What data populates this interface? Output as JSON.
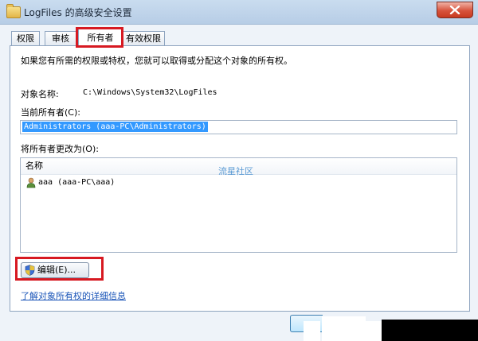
{
  "window": {
    "title": "LogFiles 的高级安全设置",
    "icon": "folder-icon",
    "close_icon": "close-icon"
  },
  "tabs": [
    {
      "label": "权限",
      "active": false
    },
    {
      "label": "审核",
      "active": false
    },
    {
      "label": "所有者",
      "active": true
    },
    {
      "label": "有效权限",
      "active": false
    }
  ],
  "owner_page": {
    "description": "如果您有所需的权限或特权，您就可以取得或分配这个对象的所有权。",
    "object_name_label": "对象名称:",
    "object_name_value": "C:\\Windows\\System32\\LogFiles",
    "current_owner_label": "当前所有者(C):",
    "current_owner_value": "Administrators (aaa-PC\\Administrators)",
    "change_owner_label": "将所有者更改为(O):",
    "list": {
      "column_header": "名称",
      "rows": [
        {
          "icon": "user-icon",
          "name": "aaa (aaa-PC\\aaa)"
        }
      ]
    },
    "watermark": "流星社区",
    "edit_button": "编辑(E)...",
    "edit_button_icon": "uac-shield-icon",
    "learn_more_link": "了解对象所有权的详细信息"
  },
  "colors": {
    "highlight_box": "#d71921",
    "selection": "#3399ff",
    "link": "#1a55b8"
  }
}
